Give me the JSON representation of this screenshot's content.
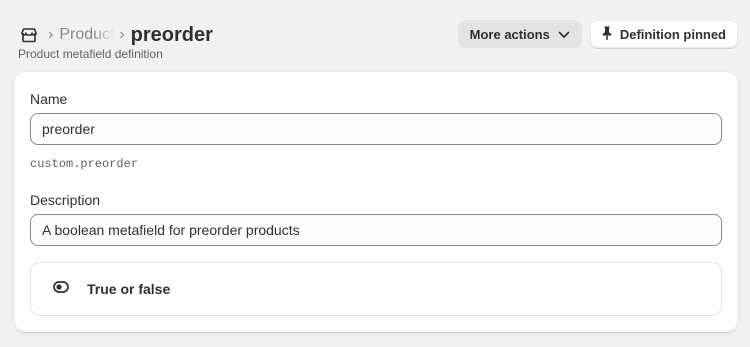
{
  "header": {
    "breadcrumb_icon": "store-icon",
    "breadcrumb_parent": "Product",
    "title": "preorder",
    "subtitle": "Product metafield definition",
    "more_actions_label": "More actions",
    "pinned_label": "Definition pinned"
  },
  "form": {
    "name_label": "Name",
    "name_value": "preorder",
    "handle": "custom.preorder",
    "description_label": "Description",
    "description_value": "A boolean metafield for preorder products",
    "type_icon": "toggle-icon",
    "type_label": "True or false"
  }
}
